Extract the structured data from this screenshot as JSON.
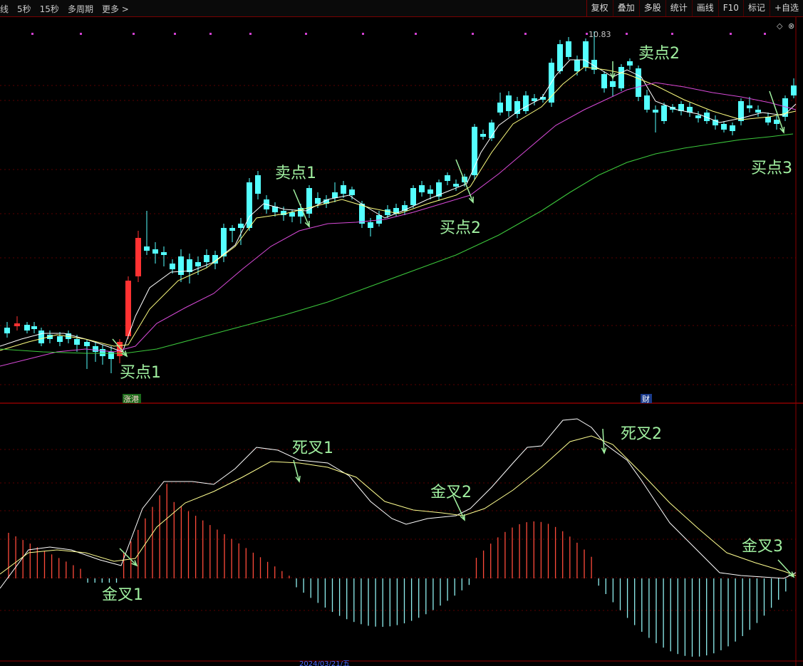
{
  "toolbar": {
    "period_left": "线",
    "periods": [
      "5秒",
      "15秒",
      "多周期",
      "更多 >"
    ],
    "right_buttons": [
      "复权",
      "叠加",
      "多股",
      "统计",
      "画线",
      "F10",
      "标记",
      "+自选"
    ]
  },
  "price_panel": {
    "high_marker": "10.83",
    "tag_zhanggang": "涨港",
    "tag_cai": "财",
    "annotations": {
      "buy1": "买点1",
      "sell1": "卖点1",
      "buy2": "买点2",
      "sell2": "卖点2",
      "buy3": "买点3"
    }
  },
  "macd_panel": {
    "annotations": {
      "golden1": "金叉1",
      "death1": "死叉1",
      "golden2": "金叉2",
      "death2": "死叉2",
      "golden3": "金叉3"
    }
  },
  "date_label": "2024/03/21/五",
  "colors": {
    "up": "#ff3232",
    "down": "#54ffff",
    "ma_short": "#ffffff",
    "ma_mid": "#ffff80",
    "ma_long": "#d84ad8",
    "ma_longest": "#3cc83c",
    "annotation": "#a0f0a0",
    "grid": "#5a0000"
  }
}
